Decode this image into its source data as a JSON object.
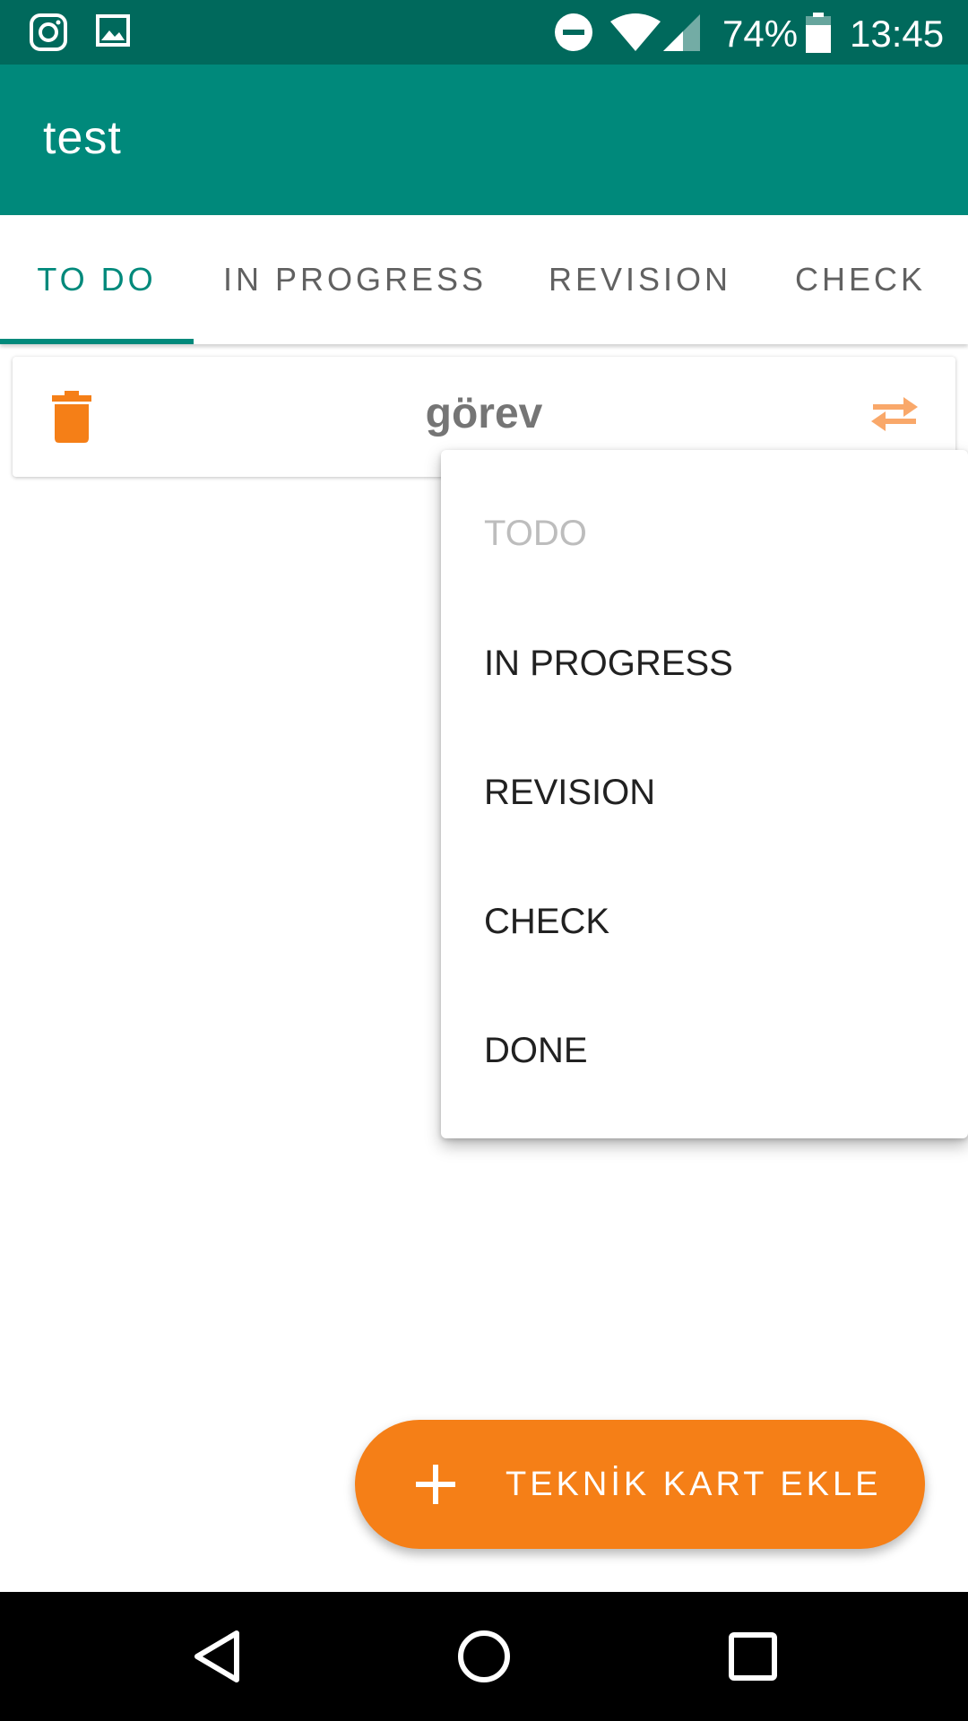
{
  "status_bar": {
    "battery_percent": "74%",
    "time": "13:45",
    "icons": [
      "instagram-icon",
      "gallery-icon",
      "do-not-disturb-icon",
      "wifi-icon",
      "signal-icon",
      "battery-icon"
    ]
  },
  "app_bar": {
    "title": "test"
  },
  "tabs": [
    {
      "label": "TO DO",
      "active": true
    },
    {
      "label": "IN PROGRESS",
      "active": false
    },
    {
      "label": "REVISION",
      "active": false
    },
    {
      "label": "CHECK",
      "active": false
    }
  ],
  "task_card": {
    "title": "görev",
    "delete_icon": "trash-icon",
    "move_icon": "swap-arrows-icon"
  },
  "move_menu": {
    "items": [
      {
        "label": "TODO",
        "enabled": false
      },
      {
        "label": "IN PROGRESS",
        "enabled": true
      },
      {
        "label": "REVISION",
        "enabled": true
      },
      {
        "label": "CHECK",
        "enabled": true
      },
      {
        "label": "DONE",
        "enabled": true
      }
    ]
  },
  "fab": {
    "label": "TEKNİK KART EKLE",
    "icon": "plus-icon"
  },
  "nav_bar": {
    "icons": [
      "back-icon",
      "home-icon",
      "recents-icon"
    ]
  },
  "colors": {
    "status_bar": "#00695c",
    "primary": "#00897b",
    "accent": "#f57f17",
    "swap_icon": "#f9a86a"
  }
}
